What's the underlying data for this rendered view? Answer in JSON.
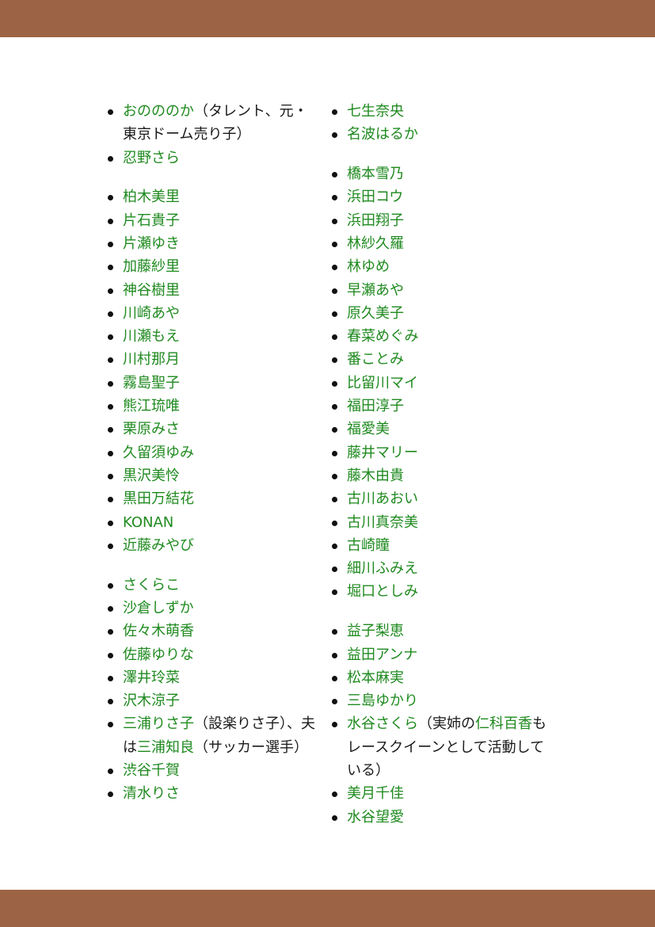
{
  "colors": {
    "bar": "#9c6444",
    "link": "#1f8a1f",
    "text": "#1a1a1a"
  },
  "left_column": [
    [
      [
        {
          "t": "おのののか",
          "link": true
        },
        {
          "t": "（タレント、元・東京ドーム売り子）",
          "link": false
        }
      ],
      [
        {
          "t": "忍野さら",
          "link": true
        }
      ]
    ],
    [
      [
        {
          "t": "柏木美里",
          "link": true
        }
      ],
      [
        {
          "t": "片石貴子",
          "link": true
        }
      ],
      [
        {
          "t": "片瀬ゆき",
          "link": true
        }
      ],
      [
        {
          "t": "加藤紗里",
          "link": true
        }
      ],
      [
        {
          "t": "神谷樹里",
          "link": true
        }
      ],
      [
        {
          "t": "川崎あや",
          "link": true
        }
      ],
      [
        {
          "t": "川瀬もえ",
          "link": true
        }
      ],
      [
        {
          "t": "川村那月",
          "link": true
        }
      ],
      [
        {
          "t": "霧島聖子",
          "link": true
        }
      ],
      [
        {
          "t": "熊江琉唯",
          "link": true
        }
      ],
      [
        {
          "t": "栗原みさ",
          "link": true
        }
      ],
      [
        {
          "t": "久留須ゆみ",
          "link": true
        }
      ],
      [
        {
          "t": "黒沢美怜",
          "link": true
        }
      ],
      [
        {
          "t": "黒田万結花",
          "link": true
        }
      ],
      [
        {
          "t": "KONAN",
          "link": true
        }
      ],
      [
        {
          "t": "近藤みやび",
          "link": true
        }
      ]
    ],
    [
      [
        {
          "t": "さくらこ",
          "link": true
        }
      ],
      [
        {
          "t": "沙倉しずか",
          "link": true
        }
      ],
      [
        {
          "t": "佐々木萌香",
          "link": true
        }
      ],
      [
        {
          "t": "佐藤ゆりな",
          "link": true
        }
      ],
      [
        {
          "t": "澤井玲菜",
          "link": true
        }
      ],
      [
        {
          "t": "沢木涼子",
          "link": true
        }
      ],
      [
        {
          "t": "三浦りさ子",
          "link": true
        },
        {
          "t": "（設楽りさ子）、夫は",
          "link": false
        },
        {
          "t": "三浦知良",
          "link": true
        },
        {
          "t": "（サッカー選手）",
          "link": false
        }
      ],
      [
        {
          "t": "渋谷千賀",
          "link": true
        }
      ],
      [
        {
          "t": "清水りさ",
          "link": true
        }
      ]
    ]
  ],
  "right_column": [
    [
      [
        {
          "t": "七生奈央",
          "link": true
        }
      ],
      [
        {
          "t": "名波はるか",
          "link": true
        }
      ]
    ],
    [
      [
        {
          "t": "橋本雪乃",
          "link": true
        }
      ],
      [
        {
          "t": "浜田コウ",
          "link": true
        }
      ],
      [
        {
          "t": "浜田翔子",
          "link": true
        }
      ],
      [
        {
          "t": "林紗久羅",
          "link": true
        }
      ],
      [
        {
          "t": "林ゆめ",
          "link": true
        }
      ],
      [
        {
          "t": "早瀬あや",
          "link": true
        }
      ],
      [
        {
          "t": "原久美子",
          "link": true
        }
      ],
      [
        {
          "t": "春菜めぐみ",
          "link": true
        }
      ],
      [
        {
          "t": "番ことみ",
          "link": true
        }
      ],
      [
        {
          "t": "比留川マイ",
          "link": true
        }
      ],
      [
        {
          "t": "福田淳子",
          "link": true
        }
      ],
      [
        {
          "t": "福愛美",
          "link": true
        }
      ],
      [
        {
          "t": "藤井マリー",
          "link": true
        }
      ],
      [
        {
          "t": "藤木由貴",
          "link": true
        }
      ],
      [
        {
          "t": "古川あおい",
          "link": true
        }
      ],
      [
        {
          "t": "古川真奈美",
          "link": true
        }
      ],
      [
        {
          "t": "古崎瞳",
          "link": true
        }
      ],
      [
        {
          "t": "細川ふみえ",
          "link": true
        }
      ],
      [
        {
          "t": "堀口としみ",
          "link": true
        }
      ]
    ],
    [
      [
        {
          "t": "益子梨恵",
          "link": true
        }
      ],
      [
        {
          "t": "益田アンナ",
          "link": true
        }
      ],
      [
        {
          "t": "松本麻実",
          "link": true
        }
      ],
      [
        {
          "t": "三島ゆかり",
          "link": true
        }
      ],
      [
        {
          "t": "水谷さくら",
          "link": true
        },
        {
          "t": "（実姉の",
          "link": false
        },
        {
          "t": "仁科百香",
          "link": true
        },
        {
          "t": "もレースクイーンとして活動している）",
          "link": false
        }
      ],
      [
        {
          "t": "美月千佳",
          "link": true
        }
      ],
      [
        {
          "t": "水谷望愛",
          "link": true
        }
      ]
    ]
  ]
}
